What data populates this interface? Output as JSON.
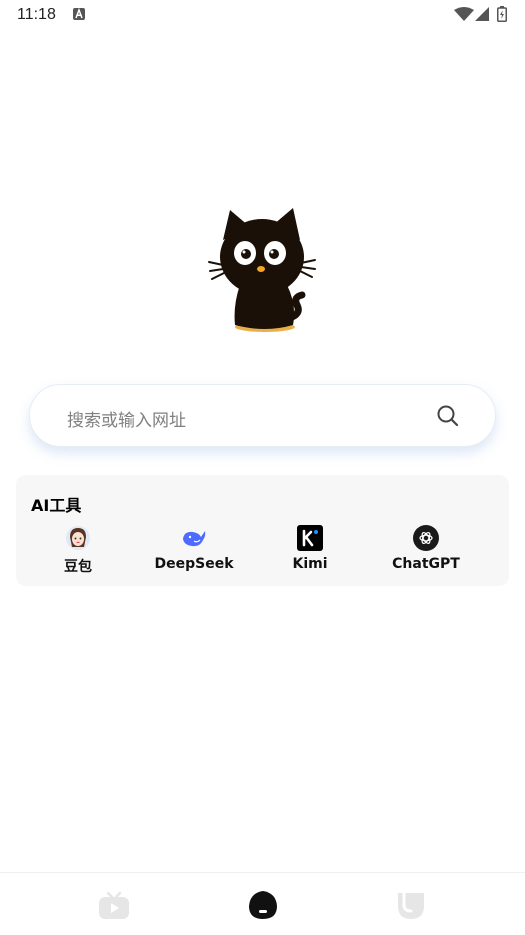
{
  "status_bar": {
    "time": "11:18",
    "icons": [
      "a-notification-icon",
      "wifi-icon",
      "signal-icon",
      "battery-icon"
    ]
  },
  "mascot": {
    "icon": "black-cat-mascot",
    "colors": {
      "body": "#1a1008",
      "nose": "#f5a623",
      "shadow": "#e8b04a"
    }
  },
  "search": {
    "placeholder": "搜索或输入网址",
    "icon": "search-icon"
  },
  "ai_tools": {
    "title": "AI工具",
    "items": [
      {
        "label": "豆包",
        "icon": "doubao-icon"
      },
      {
        "label": "DeepSeek",
        "icon": "deepseek-whale-icon",
        "color": "#4d6bfe"
      },
      {
        "label": "Kimi",
        "icon": "kimi-icon",
        "color": "#000000"
      },
      {
        "label": "ChatGPT",
        "icon": "chatgpt-icon",
        "color": "#1a1a1a"
      }
    ]
  },
  "bottom_nav": {
    "items": [
      {
        "name": "video",
        "icon": "tv-play-icon",
        "active": false
      },
      {
        "name": "home",
        "icon": "home-cat-icon",
        "active": true
      },
      {
        "name": "me",
        "icon": "profile-face-icon",
        "active": false
      }
    ],
    "colors": {
      "active": "#111111",
      "inactive": "#e6e6e6"
    }
  }
}
